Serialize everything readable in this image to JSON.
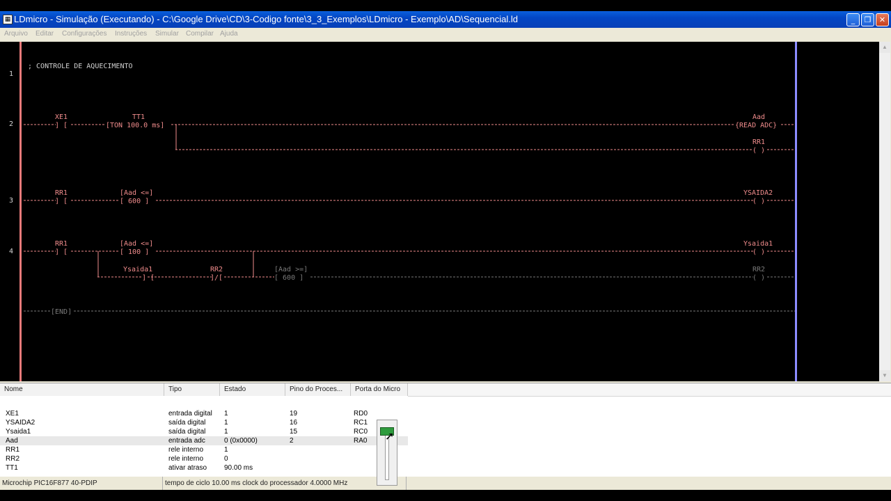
{
  "window": {
    "title": "LDmicro - Simulação (Executando) - C:\\Google Drive\\CD\\3-Codigo fonte\\3_3_Exemplos\\LDmicro - Exemplo\\AD\\Sequencial.ld",
    "icon_glyph": "▦",
    "minimize_glyph": "_",
    "maximize_glyph": "❐",
    "close_glyph": "✕"
  },
  "menu": [
    "Arquivo",
    "Editar",
    "Configurações",
    "Instruções",
    "Simular",
    "Compilar",
    "Ajuda"
  ],
  "ladder": {
    "line_numbers": [
      "1",
      "2",
      "3",
      "4"
    ],
    "comment": "; CONTROLE DE AQUECIMENTO",
    "rung2": {
      "contact": "XE1",
      "contact_sym": "] [",
      "timer_name": "TT1",
      "timer_body": "[TON 100.0 ms]",
      "adc_name": "Aad",
      "adc_body": "{READ ADC}",
      "coil_name": "RR1",
      "coil_sym": "( )"
    },
    "rung3": {
      "contact": "RR1",
      "contact_sym": "] [",
      "cmp_head": "[Aad <=]",
      "cmp_val": "[ 600  ]",
      "coil_name": "YSAIDA2",
      "coil_sym": "( )"
    },
    "rung4": {
      "contact": "RR1",
      "contact_sym": "] [",
      "cmp_head": "[Aad <=]",
      "cmp_val": "[ 100  ]",
      "coil_name": "Ysaida1",
      "coil_sym": "( )",
      "contact2": "Ysaida1",
      "contact2_sym": "] [",
      "contact3": "RR2",
      "contact3_sym": "]/[",
      "cmp2_head": "[Aad >=]",
      "cmp2_val": "[ 600  ]",
      "coil2_name": "RR2",
      "coil2_sym": "( )"
    },
    "end_label": "[END]"
  },
  "io_list": {
    "headers": [
      "Nome",
      "Tipo",
      "Estado",
      "Pino do Proces...",
      "Porta do Micro"
    ],
    "rows": [
      [
        "XE1",
        "entrada digital",
        "1",
        "19",
        "RD0"
      ],
      [
        "YSAIDA2",
        "saída digital",
        "1",
        "16",
        "RC1"
      ],
      [
        "Ysaida1",
        "saída digital",
        "1",
        "15",
        "RC0"
      ],
      [
        "Aad",
        "entrada adc",
        "0 (0x0000)",
        "2",
        "RA0"
      ],
      [
        "RR1",
        "rele interno",
        "1",
        "",
        ""
      ],
      [
        "RR2",
        "rele interno",
        "0",
        "",
        ""
      ],
      [
        "TT1",
        "ativar atraso",
        "90.00 ms",
        "",
        ""
      ]
    ],
    "selected_row": 3
  },
  "statusbar": {
    "mcu": "Microchip PIC16F877 40-PDIP",
    "cycle": "tempo de ciclo 10.00 ms  clock do processador 4.0000 MHz"
  },
  "adc_slider": {
    "value": 0
  },
  "colors": {
    "rail_left": "#E87B7B",
    "rail_right": "#8C8CFF",
    "active_wire": "#F08C8C",
    "inactive_wire": "#7A7A7A",
    "comment": "#D0D0D0",
    "title_bar": "#0A5FDB",
    "slider_thumb": "#2E9B3D"
  }
}
